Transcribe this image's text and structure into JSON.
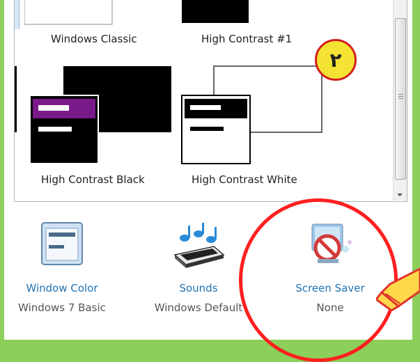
{
  "themes": [
    {
      "label": "Windows Classic"
    },
    {
      "label": "High Contrast #1"
    },
    {
      "label": "High Contrast Black"
    },
    {
      "label": "High Contrast White"
    }
  ],
  "bottom_items": [
    {
      "link": "Window Color",
      "value": "Windows 7 Basic"
    },
    {
      "link": "Sounds",
      "value": "Windows Default"
    },
    {
      "link": "Screen Saver",
      "value": "None"
    }
  ],
  "annotation": {
    "step_badge": "٢"
  },
  "colors": {
    "frame": "#8ccf5a",
    "link": "#1f73b5",
    "highlight_circle": "#ff1f1f",
    "badge_fill": "#f4e332"
  }
}
